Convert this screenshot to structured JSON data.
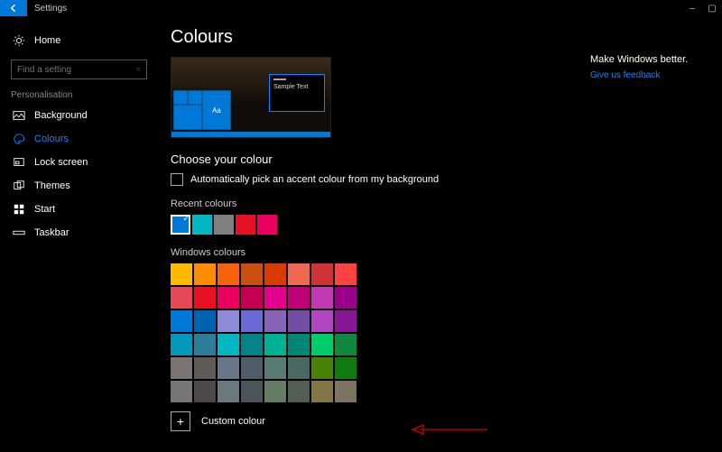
{
  "app_title": "Settings",
  "window_controls": {
    "minimize": "–",
    "maximize": "▢"
  },
  "sidebar": {
    "home": "Home",
    "search_placeholder": "Find a setting",
    "group": "Personalisation",
    "items": [
      {
        "label": "Background"
      },
      {
        "label": "Colours"
      },
      {
        "label": "Lock screen"
      },
      {
        "label": "Themes"
      },
      {
        "label": "Start"
      },
      {
        "label": "Taskbar"
      }
    ]
  },
  "page": {
    "title": "Colours",
    "preview_tile_text": "Aa",
    "preview_window_text": "Sample Text",
    "section_choose": "Choose your colour",
    "checkbox_auto": "Automatically pick an accent colour from my background",
    "recent_label": "Recent colours",
    "recent_colours": [
      "#0078d7",
      "#00b7c3",
      "#808080",
      "#e81123",
      "#ea005e"
    ],
    "windows_label": "Windows colours",
    "windows_colours": [
      "#ffb900",
      "#ff8c00",
      "#f7630c",
      "#ca5010",
      "#da3b01",
      "#ef6950",
      "#d13438",
      "#ff4343",
      "#e74856",
      "#e81123",
      "#ea005e",
      "#c30052",
      "#e3008c",
      "#bf0077",
      "#c239b3",
      "#9a0089",
      "#0078d7",
      "#0063b1",
      "#8e8cd8",
      "#6b69d6",
      "#8764b8",
      "#744da9",
      "#b146c2",
      "#881798",
      "#0099bc",
      "#2d7d9a",
      "#00b7c3",
      "#038387",
      "#00b294",
      "#018574",
      "#00cc6a",
      "#10893e",
      "#7a7574",
      "#5d5a58",
      "#68768a",
      "#515c6b",
      "#567c73",
      "#486860",
      "#498205",
      "#107c10",
      "#767676",
      "#4c4a48",
      "#69797e",
      "#4a5459",
      "#647c64",
      "#525e54",
      "#847545",
      "#7e735f"
    ],
    "custom_label": "Custom colour"
  },
  "right": {
    "heading": "Make Windows better.",
    "link": "Give us feedback"
  }
}
